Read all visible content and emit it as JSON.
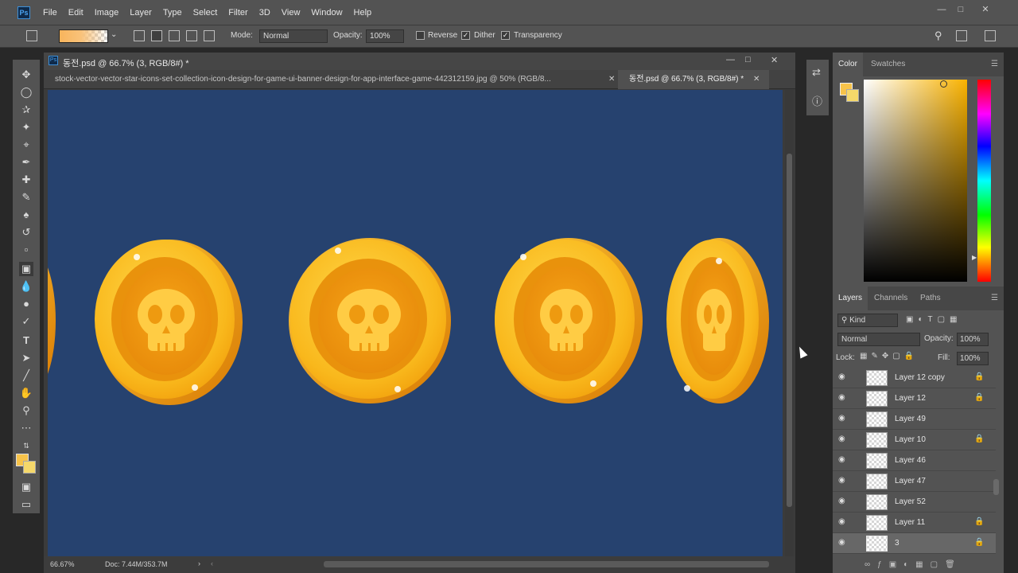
{
  "app": {
    "logo_text": "Ps"
  },
  "menu": [
    "File",
    "Edit",
    "Image",
    "Layer",
    "Type",
    "Select",
    "Filter",
    "3D",
    "View",
    "Window",
    "Help"
  ],
  "options": {
    "mode_label": "Mode:",
    "mode_value": "Normal",
    "opacity_label": "Opacity:",
    "opacity_value": "100%",
    "reverse_label": "Reverse",
    "reverse_checked": false,
    "dither_label": "Dither",
    "dither_checked": true,
    "transparency_label": "Transparency",
    "transparency_checked": true
  },
  "document": {
    "window_title": "동전.psd @ 66.7% (3, RGB/8#) *",
    "tabs": [
      {
        "label": "stock-vector-vector-star-icons-set-collection-icon-design-for-game-ui-banner-design-for-app-interface-game-442312159.jpg @ 50% (RGB/8...",
        "active": false
      },
      {
        "label": "동전.psd @ 66.7% (3, RGB/8#) *",
        "active": true
      }
    ],
    "zoom": "66.67%",
    "doc_size": "Doc: 7.44M/353.7M"
  },
  "colors": {
    "canvas_bg": "#26426f",
    "foreground": "#f7c34a",
    "background": "#f5d86a",
    "coin_gold": "#f6b41e",
    "coin_dark": "#e58a08"
  },
  "color_panel": {
    "tabs": [
      "Color",
      "Swatches"
    ]
  },
  "layers_panel": {
    "tabs": [
      "Layers",
      "Channels",
      "Paths"
    ],
    "filter_label": "Kind",
    "blend_mode": "Normal",
    "opacity_label": "Opacity:",
    "opacity_value": "100%",
    "lock_label": "Lock:",
    "fill_label": "Fill:",
    "fill_value": "100%",
    "layers": [
      {
        "name": "Layer 12 copy",
        "locked": true,
        "visible": true
      },
      {
        "name": "Layer 12",
        "locked": true,
        "visible": true
      },
      {
        "name": "Layer 49",
        "locked": false,
        "visible": true
      },
      {
        "name": "Layer 10",
        "locked": true,
        "visible": true
      },
      {
        "name": "Layer 46",
        "locked": false,
        "visible": true
      },
      {
        "name": "Layer 47",
        "locked": false,
        "visible": true
      },
      {
        "name": "Layer 52",
        "locked": false,
        "visible": true
      },
      {
        "name": "Layer 11",
        "locked": true,
        "visible": true
      },
      {
        "name": "3",
        "locked": true,
        "visible": true,
        "selected": true
      }
    ]
  },
  "icons": {
    "eye": "eye-icon",
    "lock": "lock-icon",
    "move": "move-tool-icon",
    "lasso": "lasso-tool-icon",
    "crop": "crop-tool-icon",
    "brush": "brush-tool-icon",
    "gradient": "gradient-tool-icon",
    "text": "type-tool-icon",
    "hand": "hand-tool-icon",
    "zoom": "zoom-tool-icon"
  }
}
